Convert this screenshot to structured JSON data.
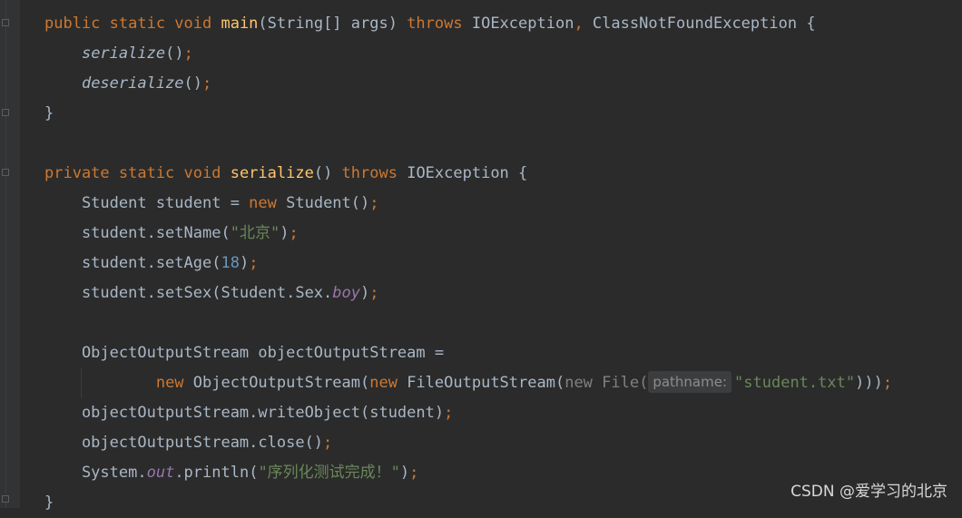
{
  "editor": {
    "language": "java",
    "colors": {
      "background": "#2b2b2b",
      "gutter": "#313335",
      "default_text": "#a9b7c6",
      "keyword": "#cc7832",
      "method_decl": "#ffc66d",
      "number": "#6897bb",
      "string": "#6a8759",
      "static_field": "#9876aa",
      "inlay_hint_bg": "#3b3d3f"
    },
    "lines": [
      {
        "tokens": [
          {
            "t": "public static void ",
            "c": "kw"
          },
          {
            "t": "main",
            "c": "fn"
          },
          {
            "t": "(String[] args) "
          },
          {
            "t": "throws ",
            "c": "kw"
          },
          {
            "t": "IOException"
          },
          {
            "t": ", ",
            "c": "kw"
          },
          {
            "t": "ClassNotFoundException {"
          }
        ]
      },
      {
        "tokens": [
          {
            "t": "    "
          },
          {
            "t": "serialize",
            "c": "it"
          },
          {
            "t": "()"
          },
          {
            "t": ";",
            "c": "kw"
          }
        ]
      },
      {
        "tokens": [
          {
            "t": "    "
          },
          {
            "t": "deserialize",
            "c": "it"
          },
          {
            "t": "()"
          },
          {
            "t": ";",
            "c": "kw"
          }
        ]
      },
      {
        "tokens": [
          {
            "t": "}"
          }
        ]
      },
      {
        "tokens": []
      },
      {
        "tokens": [
          {
            "t": "private static void ",
            "c": "kw"
          },
          {
            "t": "serialize",
            "c": "fn"
          },
          {
            "t": "() "
          },
          {
            "t": "throws ",
            "c": "kw"
          },
          {
            "t": "IOException {"
          }
        ]
      },
      {
        "tokens": [
          {
            "t": "    Student student = "
          },
          {
            "t": "new ",
            "c": "kw"
          },
          {
            "t": "Student()"
          },
          {
            "t": ";",
            "c": "kw"
          }
        ]
      },
      {
        "tokens": [
          {
            "t": "    student.setName("
          },
          {
            "t": "\"北京\"",
            "c": "str"
          },
          {
            "t": ")"
          },
          {
            "t": ";",
            "c": "kw"
          }
        ]
      },
      {
        "tokens": [
          {
            "t": "    student.setAge("
          },
          {
            "t": "18",
            "c": "num"
          },
          {
            "t": ")"
          },
          {
            "t": ";",
            "c": "kw"
          }
        ]
      },
      {
        "tokens": [
          {
            "t": "    student.setSex(Student.Sex."
          },
          {
            "t": "boy",
            "c": "field"
          },
          {
            "t": ")"
          },
          {
            "t": ";",
            "c": "kw"
          }
        ]
      },
      {
        "tokens": []
      },
      {
        "tokens": [
          {
            "t": "    ObjectOutputStream objectOutputStream ="
          }
        ]
      },
      {
        "tokens": [
          {
            "t": "            "
          },
          {
            "t": "new ",
            "c": "kw"
          },
          {
            "t": "ObjectOutputStream("
          },
          {
            "t": "new ",
            "c": "kw"
          },
          {
            "t": "FileOutputStream("
          },
          {
            "t": "new File(",
            "c": "hint-gray"
          },
          {
            "t": "pathname:",
            "c": "hint"
          },
          {
            "t": "\"student.txt\"",
            "c": "str"
          },
          {
            "t": ")))"
          },
          {
            "t": ";",
            "c": "kw"
          }
        ]
      },
      {
        "tokens": [
          {
            "t": "    objectOutputStream.writeObject(student)"
          },
          {
            "t": ";",
            "c": "kw"
          }
        ]
      },
      {
        "tokens": [
          {
            "t": "    objectOutputStream.close()"
          },
          {
            "t": ";",
            "c": "kw"
          }
        ]
      },
      {
        "tokens": [
          {
            "t": "    System."
          },
          {
            "t": "out",
            "c": "field"
          },
          {
            "t": ".println("
          },
          {
            "t": "\"序列化测试完成！\"",
            "c": "str"
          },
          {
            "t": ")"
          },
          {
            "t": ";",
            "c": "kw"
          }
        ]
      },
      {
        "tokens": [
          {
            "t": "}"
          }
        ]
      }
    ]
  },
  "watermark": "CSDN @爱学习的北京"
}
